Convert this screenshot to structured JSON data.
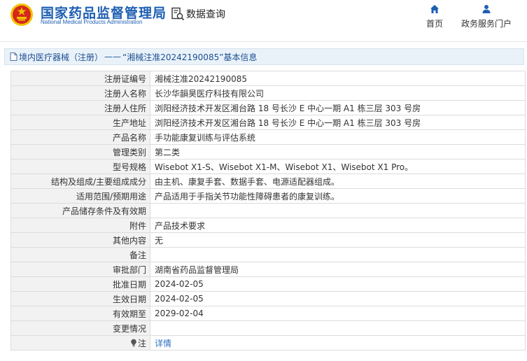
{
  "header": {
    "brand_cn": "国家药品监督管理局",
    "brand_en": "National Medical Products Administration",
    "search_label": "数据查询",
    "nav": [
      {
        "label": "首页",
        "icon": "home-icon"
      },
      {
        "label": "政务服务门户",
        "icon": "user-icon"
      }
    ]
  },
  "breadcrumb": {
    "category": "境内医疗器械（注册）",
    "separator": "——",
    "record": "“湘械注准20242190085”基本信息"
  },
  "details": {
    "rows": [
      {
        "label": "注册证编号",
        "value": "湘械注准20242190085"
      },
      {
        "label": "注册人名称",
        "value": "长沙华韻昊医疗科技有限公司"
      },
      {
        "label": "注册人住所",
        "value": "浏阳经济技术开发区湘台路 18 号长沙 E 中心一期 A1 栋三层 303 号房"
      },
      {
        "label": "生产地址",
        "value": "浏阳经济技术开发区湘台路 18 号长沙 E 中心一期 A1 栋三层 303 号房"
      },
      {
        "label": "产品名称",
        "value": "手功能康复训练与评估系统"
      },
      {
        "label": "管理类别",
        "value": "第二类"
      },
      {
        "label": "型号规格",
        "value": "Wisebot X1-S、Wisebot X1-M、Wisebot X1、Wisebot X1 Pro。"
      },
      {
        "label": "结构及组成/主要组成成分",
        "value": "由主机、康复手套、数据手套、电源适配器组成。"
      },
      {
        "label": "适用范围/预期用途",
        "value": "产品适用于手指关节功能性障碍患者的康复训练。"
      },
      {
        "label": "产品储存条件及有效期",
        "value": ""
      },
      {
        "label": "附件",
        "value": "产品技术要求"
      },
      {
        "label": "其他内容",
        "value": "无"
      },
      {
        "label": "备注",
        "value": ""
      },
      {
        "label": "审批部门",
        "value": "湖南省药品监督管理局"
      },
      {
        "label": "批准日期",
        "value": "2024-02-05"
      },
      {
        "label": "生效日期",
        "value": "2024-02-05"
      },
      {
        "label": "有效期至",
        "value": "2029-02-04"
      },
      {
        "label": "变更情况",
        "value": ""
      }
    ],
    "note": {
      "label": "注",
      "link": "详情"
    }
  },
  "colors": {
    "brand_blue": "#1e5fb3",
    "label_bg": "#f2f2f2",
    "crumb_bg": "#eaf2f9",
    "link_blue": "#2c6fbf",
    "emblem_red": "#d4281c",
    "emblem_gold": "#f2c200"
  }
}
